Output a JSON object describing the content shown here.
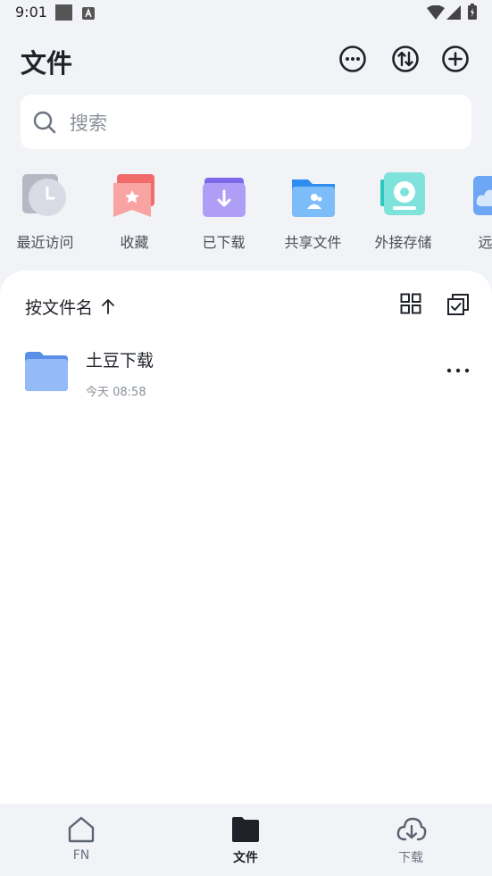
{
  "status_bar": {
    "time": "9:01"
  },
  "header": {
    "title": "文件"
  },
  "search": {
    "placeholder": "搜索"
  },
  "quick_access": [
    {
      "label": "最近访问",
      "icon": "clock-icon"
    },
    {
      "label": "收藏",
      "icon": "bookmark-star-icon"
    },
    {
      "label": "已下载",
      "icon": "download-folder-icon"
    },
    {
      "label": "共享文件",
      "icon": "shared-folder-icon"
    },
    {
      "label": "外接存储",
      "icon": "external-storage-icon"
    },
    {
      "label": "远程",
      "icon": "remote-cloud-icon"
    }
  ],
  "file_list": {
    "sort_label": "按文件名",
    "files": [
      {
        "name": "土豆下载",
        "modified": "今天 08:58",
        "icon": "folder-icon"
      }
    ]
  },
  "bottom_nav": [
    {
      "label": "FN",
      "icon": "home-icon",
      "active": false
    },
    {
      "label": "文件",
      "icon": "folder-icon",
      "active": true
    },
    {
      "label": "下载",
      "icon": "cloud-download-icon",
      "active": false
    }
  ],
  "colors": {
    "background": "#f2f3f7",
    "text_primary": "#1f2329",
    "text_secondary": "#8a9099",
    "folder_blue": "#7aa7f5"
  }
}
